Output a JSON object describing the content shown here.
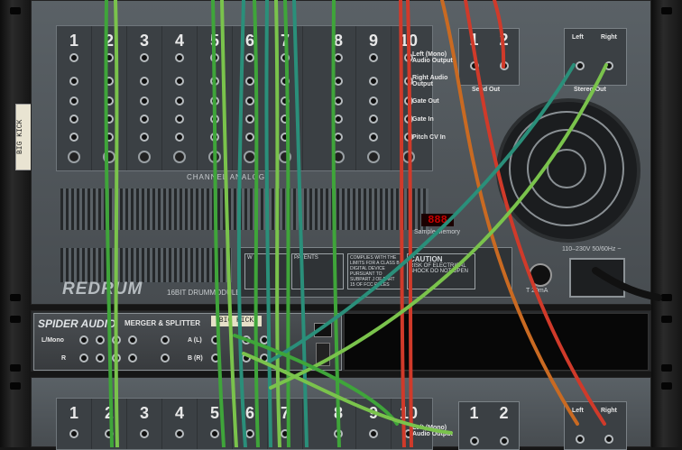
{
  "left_rail": {
    "tape_label": "BIG KICK"
  },
  "redrum": {
    "channel_numbers": [
      "1",
      "2",
      "3",
      "4",
      "5",
      "6",
      "7",
      "8",
      "9",
      "10"
    ],
    "section_title": "CHANNEL ANALOG",
    "jack_labels": [
      "Left (Mono) Audio Output",
      "Right Audio Output",
      "Gate Out",
      "Gate In",
      "Pitch CV In"
    ],
    "send_out": {
      "numbers": [
        "1",
        "2"
      ],
      "label": "Send Out"
    },
    "stereo_out": {
      "left": "Left",
      "right": "Right",
      "label": "Stereo Out"
    },
    "sample_memory_label": "Sample Memory",
    "sample_memory_display": "888",
    "logo": "REDRUM",
    "logo_sub": "16BIT DRUMMODULE",
    "plate": {
      "warning_title": "W",
      "patents_title": "PATENTS",
      "complies_text": "COMPLIES WITH THE LIMITS FOR A CLASS B DIGITAL DEVICE PURSUANT TO SUBPART J OF PART 15 OF FCC RULES",
      "caution_title": "CAUTION",
      "caution_text": "RISK OF ELECTRICAL SHOCK DO NOT OPEN"
    },
    "voltage": "110–230V 50/60Hz ~",
    "fuse_label": "T 20mA"
  },
  "spider": {
    "logo": "SPIDER AUDIO",
    "subtitle": "MERGER & SPLITTER",
    "tape_label": "BIG KICK",
    "row_labels": [
      "L/Mono",
      "R"
    ],
    "split_labels": [
      "A (L)",
      "B (R)"
    ]
  },
  "redrum2": {
    "channel_numbers": [
      "1",
      "2",
      "3",
      "4",
      "5",
      "6",
      "7",
      "8",
      "9",
      "10"
    ],
    "jack_label": "Left (Mono) Audio Output",
    "send_numbers": [
      "1",
      "2"
    ],
    "stereo_left": "Left",
    "stereo_right": "Right"
  },
  "colors": {
    "cable_green": "#3fa53a",
    "cable_lightgreen": "#7ac34c",
    "cable_teal": "#2a8f7a",
    "cable_red": "#d03a2a",
    "cable_orange": "#c96a22"
  }
}
